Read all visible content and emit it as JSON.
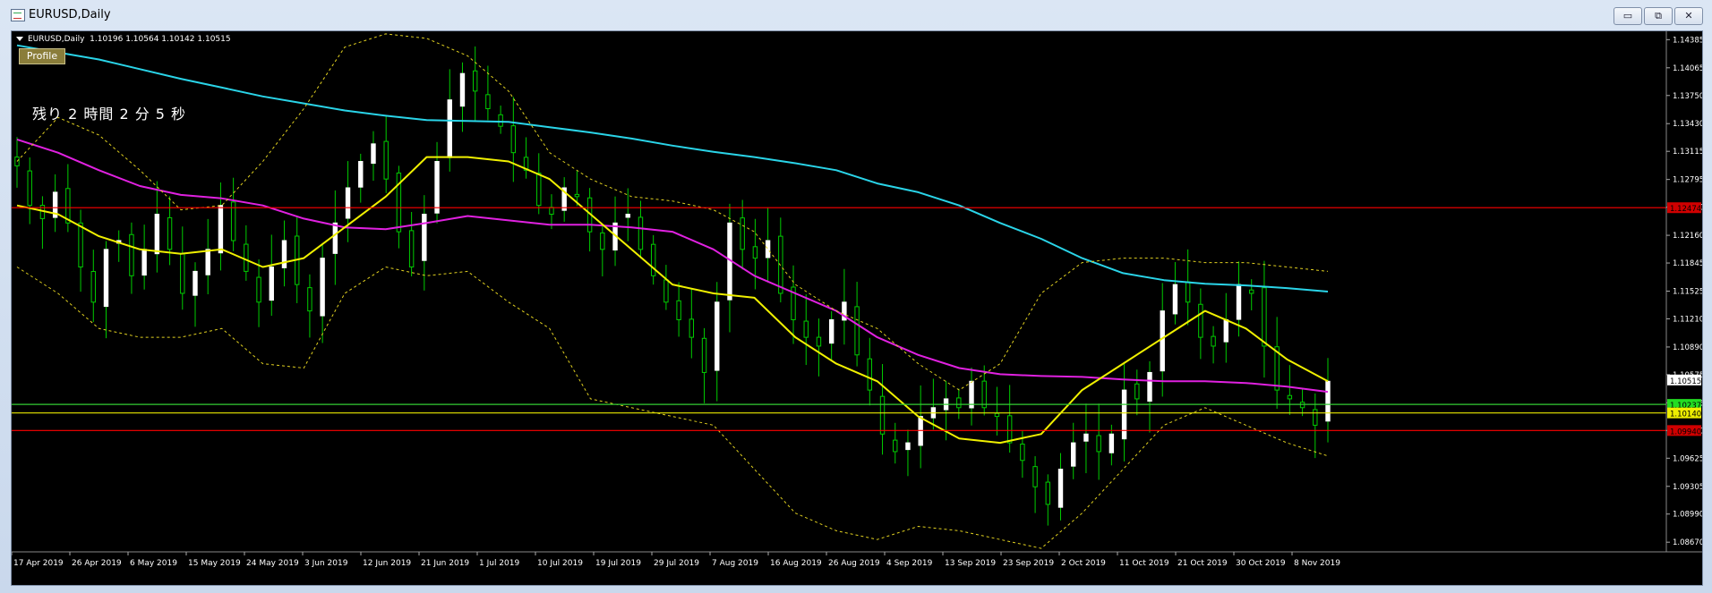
{
  "window": {
    "title": "EURUSD,Daily",
    "buttons": {
      "minimize": "▭",
      "restore": "⧉",
      "close": "✕"
    }
  },
  "chart_info": {
    "symbol": "EURUSD,Daily",
    "ohlc": "1.10196 1.10564 1.10142 1.10515"
  },
  "profile_label": "Profile",
  "timer_text": "残り 2 時間 2 分 5 秒",
  "chart_data": {
    "type": "candlestick",
    "symbol": "EURUSD",
    "timeframe": "Daily",
    "ylim": [
      1.0856,
      1.1448
    ],
    "y_ticks": [
      "1.14385",
      "1.14065",
      "1.13750",
      "1.13430",
      "1.13115",
      "1.12795",
      "1.12480",
      "1.12160",
      "1.11845",
      "1.11525",
      "1.11210",
      "1.10890",
      "1.10575",
      "1.10255",
      "1.09940",
      "1.09625",
      "1.09305",
      "1.08990",
      "1.08670"
    ],
    "x_labels": [
      "17 Apr 2019",
      "26 Apr 2019",
      "6 May 2019",
      "15 May 2019",
      "24 May 2019",
      "3 Jun 2019",
      "12 Jun 2019",
      "21 Jun 2019",
      "1 Jul 2019",
      "10 Jul 2019",
      "19 Jul 2019",
      "29 Jul 2019",
      "7 Aug 2019",
      "16 Aug 2019",
      "26 Aug 2019",
      "4 Sep 2019",
      "13 Sep 2019",
      "23 Sep 2019",
      "2 Oct 2019",
      "11 Oct 2019",
      "21 Oct 2019",
      "30 Oct 2019",
      "8 Nov 2019"
    ],
    "close_path": [
      1.1295,
      1.125,
      1.1235,
      1.1265,
      1.123,
      1.118,
      1.114,
      1.12,
      1.121,
      1.117,
      1.12,
      1.124,
      1.12,
      1.115,
      1.1175,
      1.12,
      1.125,
      1.121,
      1.1175,
      1.114,
      1.118,
      1.121,
      1.116,
      1.113,
      1.119,
      1.123,
      1.127,
      1.13,
      1.132,
      1.128,
      1.122,
      1.118,
      1.124,
      1.13,
      1.137,
      1.14,
      1.138,
      1.136,
      1.134,
      1.131,
      1.129,
      1.125,
      1.124,
      1.127,
      1.126,
      1.122,
      1.12,
      1.123,
      1.124,
      1.12,
      1.117,
      1.114,
      1.112,
      1.11,
      1.106,
      1.114,
      1.123,
      1.12,
      1.119,
      1.121,
      1.115,
      1.112,
      1.11,
      1.109,
      1.112,
      1.114,
      1.108,
      1.104,
      1.099,
      1.097,
      1.098,
      1.101,
      1.102,
      1.103,
      1.102,
      1.105,
      1.102,
      1.101,
      1.098,
      1.096,
      1.093,
      1.091,
      1.095,
      1.098,
      1.099,
      1.097,
      1.099,
      1.104,
      1.103,
      1.106,
      1.113,
      1.116,
      1.114,
      1.11,
      1.109,
      1.112,
      1.116,
      1.115,
      1.109,
      1.104,
      1.103,
      1.102,
      1.1,
      1.105
    ],
    "indicators": [
      {
        "name": "MA cyan",
        "color": "#2ad4e8",
        "values": [
          1.1432,
          1.1424,
          1.1416,
          1.1405,
          1.1394,
          1.1384,
          1.1374,
          1.1366,
          1.1358,
          1.1352,
          1.1347,
          1.1346,
          1.1345,
          1.1339,
          1.1333,
          1.1326,
          1.1318,
          1.1311,
          1.1305,
          1.1298,
          1.129,
          1.1275,
          1.1265,
          1.125,
          1.123,
          1.1212,
          1.119,
          1.1173,
          1.1165,
          1.1161,
          1.1159,
          1.1156,
          1.1152
        ]
      },
      {
        "name": "MA magenta",
        "color": "#e021e0",
        "values": [
          1.1325,
          1.131,
          1.129,
          1.1272,
          1.1262,
          1.1258,
          1.125,
          1.1235,
          1.1225,
          1.1223,
          1.123,
          1.1238,
          1.1233,
          1.1228,
          1.1228,
          1.1225,
          1.122,
          1.12,
          1.117,
          1.115,
          1.113,
          1.11,
          1.108,
          1.1065,
          1.1058,
          1.1056,
          1.1055,
          1.1052,
          1.105,
          1.105,
          1.1048,
          1.1044,
          1.1038
        ]
      },
      {
        "name": "MA yellow",
        "color": "#f0f000",
        "values": [
          1.125,
          1.124,
          1.1215,
          1.12,
          1.1195,
          1.12,
          1.118,
          1.119,
          1.1225,
          1.126,
          1.1305,
          1.1305,
          1.13,
          1.128,
          1.124,
          1.12,
          1.116,
          1.115,
          1.1145,
          1.11,
          1.107,
          1.105,
          1.101,
          1.0985,
          1.098,
          1.099,
          1.104,
          1.107,
          1.11,
          1.113,
          1.111,
          1.1075,
          1.105
        ]
      },
      {
        "name": "Bollinger upper",
        "color": "#e0d020",
        "style": "dashed",
        "values": [
          1.13,
          1.135,
          1.133,
          1.129,
          1.1245,
          1.125,
          1.13,
          1.136,
          1.143,
          1.1445,
          1.144,
          1.142,
          1.138,
          1.131,
          1.128,
          1.126,
          1.1255,
          1.1245,
          1.122,
          1.116,
          1.113,
          1.111,
          1.107,
          1.104,
          1.107,
          1.115,
          1.1185,
          1.119,
          1.119,
          1.1185,
          1.1185,
          1.118,
          1.1175
        ]
      },
      {
        "name": "Bollinger lower",
        "color": "#e0d020",
        "style": "dashed",
        "values": [
          1.118,
          1.115,
          1.111,
          1.11,
          1.11,
          1.111,
          1.107,
          1.1065,
          1.115,
          1.118,
          1.117,
          1.1175,
          1.114,
          1.111,
          1.103,
          1.102,
          1.101,
          1.1,
          1.095,
          1.09,
          1.088,
          1.087,
          1.0885,
          1.088,
          1.087,
          1.086,
          1.09,
          1.095,
          1.1,
          1.102,
          1.1,
          1.098,
          1.0965
        ]
      }
    ],
    "horizontal_lines": [
      {
        "price": 1.12474,
        "color": "#ff0000",
        "label": "1.12474",
        "label_bg": "#d00000",
        "label_fg": "#000000"
      },
      {
        "price": 1.10237,
        "color": "#33cc33",
        "label": "1.10237",
        "label_bg": "#22dd22",
        "label_fg": "#000000"
      },
      {
        "price": 1.1014,
        "color": "#e8e800",
        "label": "1.10140",
        "label_bg": "#eeee00",
        "label_fg": "#000000"
      },
      {
        "price": 1.0994,
        "color": "#ff0000",
        "label": "1.09940",
        "label_bg": "#d00000",
        "label_fg": "#000000"
      }
    ],
    "current_price": {
      "label": "1.10515",
      "label_bg": "#ffffff",
      "label_fg": "#000000"
    },
    "candle_colors": {
      "up": "#ffffff",
      "down": "#00cc00",
      "wick": "#00cc00"
    },
    "background": "#000000"
  }
}
